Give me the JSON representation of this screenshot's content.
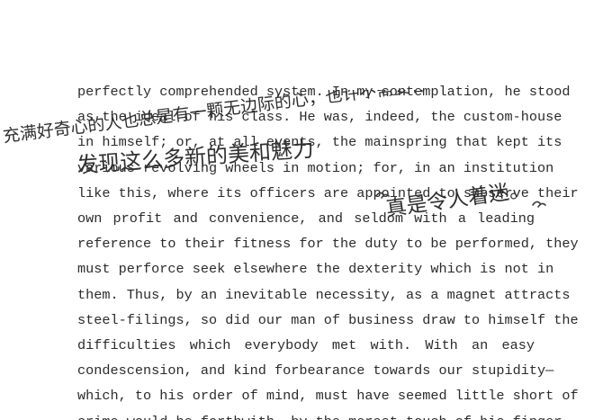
{
  "document": {
    "lines": [
      "perfectly comprehended system. In my contemplation, he stood",
      "as the ideal of his class. He was, indeed, the custom-house",
      "in himself; or, at all events, the mainspring that kept its",
      "various revolving wheels in motion; for, in an institution",
      "like this, where its officers are appointed to subserve their",
      "own profit and convenience, and seldom with a leading",
      "reference to their fitness for the duty to be performed, they",
      "must perforce seek elsewhere the dexterity which is not in",
      "them. Thus, by an inevitable necessity, as a magnet attracts",
      "steel-filings, so did our man of business draw to himself the",
      "difficulties which everybody met with. With an easy",
      "condescension, and kind forbearance towards our stupidity—",
      "which, to his order of mind, must have seemed little short of",
      "crime—would he forthwith, by the merest touch of his finger,"
    ]
  },
  "annotation": {
    "line1": "充满好奇心的人也总是有一颗无边际的心，也许不需要什么",
    "line2": "发现这么多新的美和魅力",
    "line3": "真是令人着迷。"
  }
}
